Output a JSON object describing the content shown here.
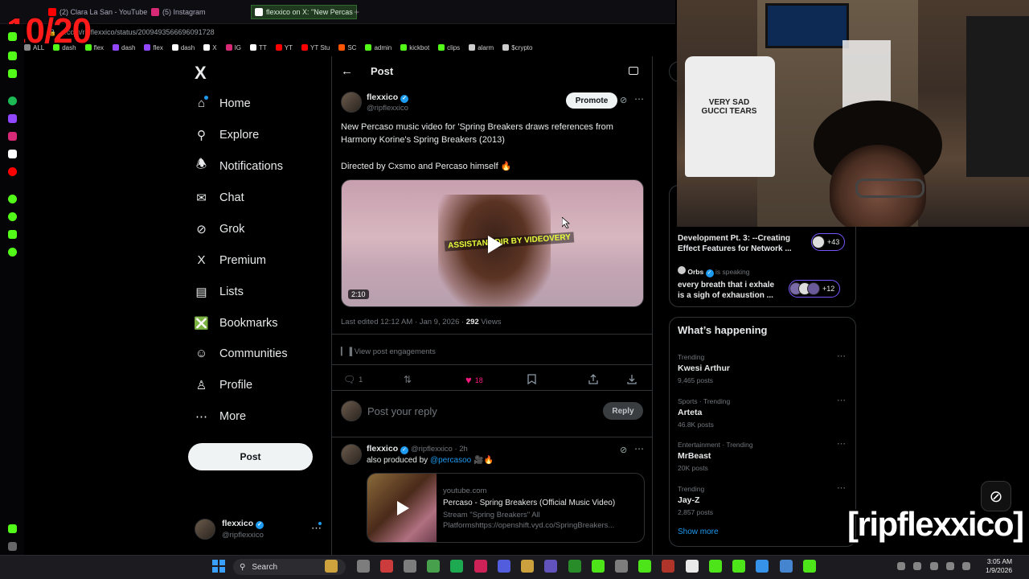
{
  "overlay": {
    "counter": "10/20",
    "watermark": "[ripflexxico]"
  },
  "browser": {
    "tabs": [
      {
        "label": "(2) Clara La San - YouTube",
        "icon": "youtube-icon",
        "color": "#ff0000"
      },
      {
        "label": "(5) Instagram",
        "icon": "instagram-icon",
        "color": "#d62976"
      },
      {
        "label": "flexxico on X: \"New Percas",
        "icon": "x-icon",
        "color": "#ffffff"
      }
    ],
    "url": "x.com/ripflexxico/status/2009493566696091728",
    "bookmarks": [
      {
        "label": "ALL",
        "color": "#888888"
      },
      {
        "label": "dash",
        "color": "#53fc18"
      },
      {
        "label": "flex",
        "color": "#53fc18"
      },
      {
        "label": "dash",
        "color": "#9146ff"
      },
      {
        "label": "flex",
        "color": "#9146ff"
      },
      {
        "label": "dash",
        "color": "#ffffff"
      },
      {
        "label": "X",
        "color": "#ffffff"
      },
      {
        "label": "IG",
        "color": "#d62976"
      },
      {
        "label": "TT",
        "color": "#ffffff"
      },
      {
        "label": "YT",
        "color": "#ff0000"
      },
      {
        "label": "YT Stu",
        "color": "#ff0000"
      },
      {
        "label": "SC",
        "color": "#ff5500"
      },
      {
        "label": "admin",
        "color": "#53fc18"
      },
      {
        "label": "kickbot",
        "color": "#53fc18"
      },
      {
        "label": "clips",
        "color": "#53fc18"
      },
      {
        "label": "alarm",
        "color": "#cccccc"
      },
      {
        "label": "$crypto",
        "color": "#cccccc"
      }
    ]
  },
  "nav": {
    "logo": "X",
    "items": [
      {
        "label": "Home",
        "icon": "home-icon"
      },
      {
        "label": "Explore",
        "icon": "search-icon"
      },
      {
        "label": "Notifications",
        "icon": "bell-icon"
      },
      {
        "label": "Chat",
        "icon": "mail-icon"
      },
      {
        "label": "Grok",
        "icon": "grok-icon"
      },
      {
        "label": "Premium",
        "icon": "x-premium-icon"
      },
      {
        "label": "Lists",
        "icon": "list-icon"
      },
      {
        "label": "Bookmarks",
        "icon": "bookmark-icon"
      },
      {
        "label": "Communities",
        "icon": "people-icon"
      },
      {
        "label": "Profile",
        "icon": "person-icon"
      },
      {
        "label": "More",
        "icon": "more-circle-icon"
      }
    ],
    "post_label": "Post",
    "account": {
      "name": "flexxico",
      "handle": "@ripflexxico"
    }
  },
  "main": {
    "header_title": "Post",
    "post": {
      "author": "flexxico",
      "handle": "@ripflexxico",
      "promote_label": "Promote",
      "text_line1": "New Percaso music video for 'Spring Breakers draws references from",
      "text_line2": "Harmony Korine's Spring Breakers (2013)",
      "text_line3": "Directed by Cxsmo and Percaso himself 🔥",
      "video_overlay": "ASSISTANT DIR BY VIDEOVERY",
      "video_duration": "2:10",
      "edited": "Last edited 12:12 AM · Jan 9, 2026 · ",
      "views_count": "292",
      "views_label": " Views",
      "engagements": "View post engagements",
      "replies": "1",
      "likes": "18"
    },
    "reply_box": {
      "placeholder": "Post your reply",
      "button": "Reply"
    },
    "reply": {
      "author": "flexxico",
      "handle_time": "@ripflexxico · 2h",
      "text_prefix": "also produced by ",
      "mention": "@percasoo",
      "text_suffix": " 🎥🔥",
      "card": {
        "domain": "youtube.com",
        "title": "Percaso - Spring Breakers (Official Music Video)",
        "desc1": "Stream \"Spring Breakers\" All",
        "desc2": "Platformshttps://openshift.vyd.co/SpringBreakers..."
      }
    }
  },
  "right": {
    "spaces": [
      {
        "title_line1": "Development Pt. 3: --Creating",
        "title_line2": "Effect Features for Network ...",
        "count": "+43"
      },
      {
        "host": "Orbs",
        "status": "is speaking",
        "title_line1": "every breath that i exhale",
        "title_line2": "is a sigh of exhaustion ...",
        "count": "+12"
      }
    ],
    "happening_title": "What’s happening",
    "trends": [
      {
        "category": "Trending",
        "name": "Kwesi Arthur",
        "count": "9,465 posts"
      },
      {
        "category": "Sports · Trending",
        "name": "Arteta",
        "count": "46.8K posts"
      },
      {
        "category": "Entertainment · Trending",
        "name": "MrBeast",
        "count": "20K posts"
      },
      {
        "category": "Trending",
        "name": "Jay-Z",
        "count": "2,857 posts"
      }
    ],
    "show_more": "Show more"
  },
  "webcam": {
    "shirt_text": "VERY SAD GUCCI TEARS"
  },
  "taskbar": {
    "search_label": "Search",
    "time": "3:05 AM",
    "date": "1/9/2026"
  }
}
